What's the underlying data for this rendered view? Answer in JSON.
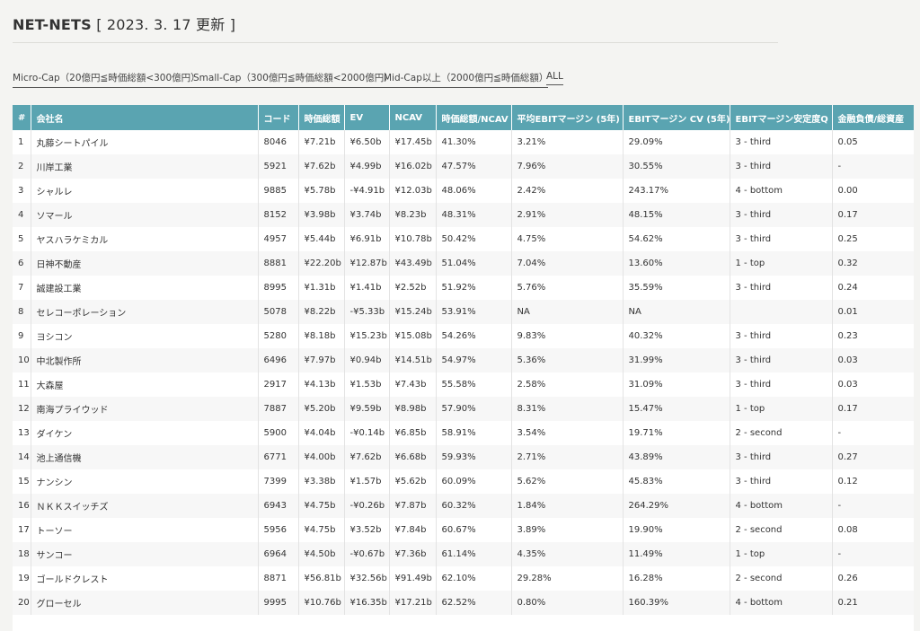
{
  "header": {
    "title": "NET-NETS",
    "date": "[ 2023. 3. 17 更新 ]"
  },
  "filters": [
    {
      "label": "Micro-Cap（20億円≦時価総額<300億円）"
    },
    {
      "label": "Small-Cap（300億円≦時価総額<2000億円）"
    },
    {
      "label": "Mid-Cap以上（2000億円≦時価総額）"
    },
    {
      "label": "ALL"
    }
  ],
  "table": {
    "columns": [
      "#",
      "会社名",
      "コード",
      "時価総額",
      "EV",
      "NCAV",
      "時価総額/NCAV",
      "平均EBITマージン (5年)",
      "EBITマージン CV (5年)",
      "EBITマージン安定度Q",
      "金融負債/総資産"
    ],
    "rows": [
      [
        "1",
        "丸藤シートパイル",
        "8046",
        "¥7.21b",
        "¥6.50b",
        "¥17.45b",
        "41.30%",
        "3.21%",
        "29.09%",
        "3 - third",
        "0.05"
      ],
      [
        "2",
        "川岸工業",
        "5921",
        "¥7.62b",
        "¥4.99b",
        "¥16.02b",
        "47.57%",
        "7.96%",
        "30.55%",
        "3 - third",
        "-"
      ],
      [
        "3",
        "シャルレ",
        "9885",
        "¥5.78b",
        "-¥4.91b",
        "¥12.03b",
        "48.06%",
        "2.42%",
        "243.17%",
        "4 - bottom",
        "0.00"
      ],
      [
        "4",
        "ソマール",
        "8152",
        "¥3.98b",
        "¥3.74b",
        "¥8.23b",
        "48.31%",
        "2.91%",
        "48.15%",
        "3 - third",
        "0.17"
      ],
      [
        "5",
        "ヤスハラケミカル",
        "4957",
        "¥5.44b",
        "¥6.91b",
        "¥10.78b",
        "50.42%",
        "4.75%",
        "54.62%",
        "3 - third",
        "0.25"
      ],
      [
        "6",
        "日神不動産",
        "8881",
        "¥22.20b",
        "¥12.87b",
        "¥43.49b",
        "51.04%",
        "7.04%",
        "13.60%",
        "1 - top",
        "0.32"
      ],
      [
        "7",
        "誠建設工業",
        "8995",
        "¥1.31b",
        "¥1.41b",
        "¥2.52b",
        "51.92%",
        "5.76%",
        "35.59%",
        "3 - third",
        "0.24"
      ],
      [
        "8",
        "セレコーポレーション",
        "5078",
        "¥8.22b",
        "-¥5.33b",
        "¥15.24b",
        "53.91%",
        "NA",
        "NA",
        "",
        "0.01"
      ],
      [
        "9",
        "ヨシコン",
        "5280",
        "¥8.18b",
        "¥15.23b",
        "¥15.08b",
        "54.26%",
        "9.83%",
        "40.32%",
        "3 - third",
        "0.23"
      ],
      [
        "10",
        "中北製作所",
        "6496",
        "¥7.97b",
        "¥0.94b",
        "¥14.51b",
        "54.97%",
        "5.36%",
        "31.99%",
        "3 - third",
        "0.03"
      ],
      [
        "11",
        "大森屋",
        "2917",
        "¥4.13b",
        "¥1.53b",
        "¥7.43b",
        "55.58%",
        "2.58%",
        "31.09%",
        "3 - third",
        "0.03"
      ],
      [
        "12",
        "南海プライウッド",
        "7887",
        "¥5.20b",
        "¥9.59b",
        "¥8.98b",
        "57.90%",
        "8.31%",
        "15.47%",
        "1 - top",
        "0.17"
      ],
      [
        "13",
        "ダイケン",
        "5900",
        "¥4.04b",
        "-¥0.14b",
        "¥6.85b",
        "58.91%",
        "3.54%",
        "19.71%",
        "2 - second",
        "-"
      ],
      [
        "14",
        "池上通信機",
        "6771",
        "¥4.00b",
        "¥7.62b",
        "¥6.68b",
        "59.93%",
        "2.71%",
        "43.89%",
        "3 - third",
        "0.27"
      ],
      [
        "15",
        "ナンシン",
        "7399",
        "¥3.38b",
        "¥1.57b",
        "¥5.62b",
        "60.09%",
        "5.62%",
        "45.83%",
        "3 - third",
        "0.12"
      ],
      [
        "16",
        "ＮＫＫスイッチズ",
        "6943",
        "¥4.75b",
        "-¥0.26b",
        "¥7.87b",
        "60.32%",
        "1.84%",
        "264.29%",
        "4 - bottom",
        "-"
      ],
      [
        "17",
        "トーソー",
        "5956",
        "¥4.75b",
        "¥3.52b",
        "¥7.84b",
        "60.67%",
        "3.89%",
        "19.90%",
        "2 - second",
        "0.08"
      ],
      [
        "18",
        "サンコー",
        "6964",
        "¥4.50b",
        "-¥0.67b",
        "¥7.36b",
        "61.14%",
        "4.35%",
        "11.49%",
        "1 - top",
        "-"
      ],
      [
        "19",
        "ゴールドクレスト",
        "8871",
        "¥56.81b",
        "¥32.56b",
        "¥91.49b",
        "62.10%",
        "29.28%",
        "16.28%",
        "2 - second",
        "0.26"
      ],
      [
        "20",
        "グローセル",
        "9995",
        "¥10.76b",
        "¥16.35b",
        "¥17.21b",
        "62.52%",
        "0.80%",
        "160.39%",
        "4 - bottom",
        "0.21"
      ]
    ]
  }
}
